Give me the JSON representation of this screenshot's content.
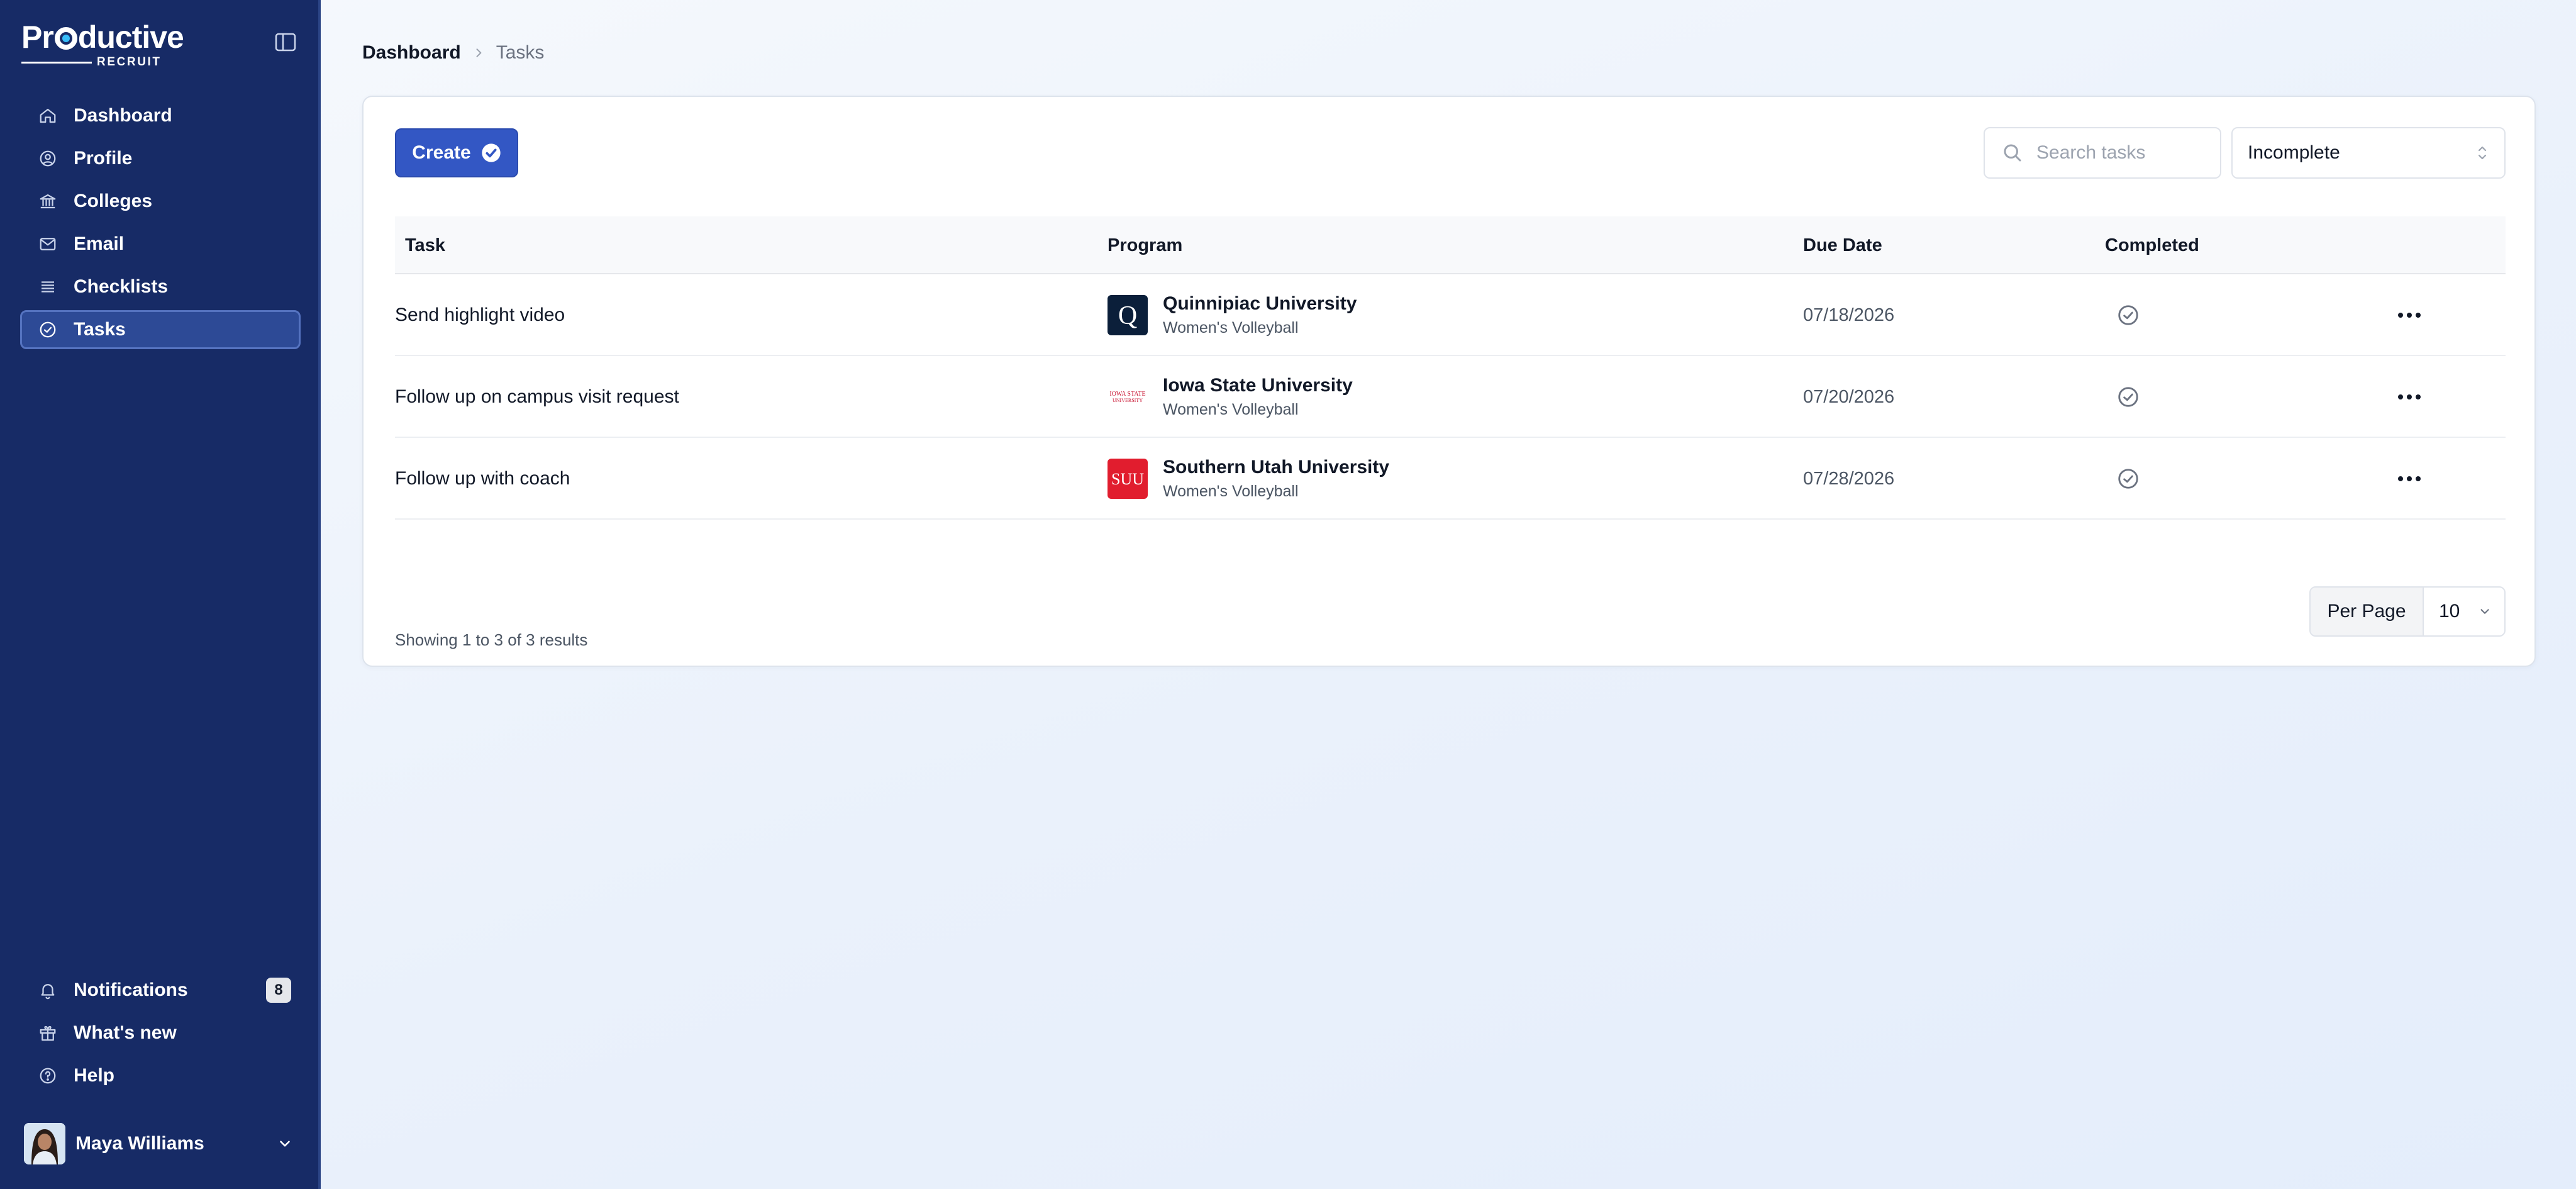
{
  "app": {
    "logo_main_pre": "Pr",
    "logo_main_post": "ductive",
    "logo_sub": "RECRUIT"
  },
  "sidebar": {
    "items": [
      {
        "label": "Dashboard",
        "icon": "home-icon"
      },
      {
        "label": "Profile",
        "icon": "user-circle-icon"
      },
      {
        "label": "Colleges",
        "icon": "building-icon"
      },
      {
        "label": "Email",
        "icon": "envelope-icon"
      },
      {
        "label": "Checklists",
        "icon": "list-icon"
      },
      {
        "label": "Tasks",
        "icon": "check-circle-icon",
        "active": true
      }
    ],
    "bottom_items": [
      {
        "label": "Notifications",
        "icon": "bell-icon",
        "badge": "8"
      },
      {
        "label": "What's new",
        "icon": "gift-icon"
      },
      {
        "label": "Help",
        "icon": "question-circle-icon"
      }
    ],
    "user": {
      "name": "Maya Williams"
    }
  },
  "breadcrumb": {
    "items": [
      "Dashboard",
      "Tasks"
    ]
  },
  "toolbar": {
    "create_label": "Create",
    "search_placeholder": "Search tasks",
    "status_filter": "Incomplete"
  },
  "table": {
    "headers": [
      "Task",
      "Program",
      "Due Date",
      "Completed"
    ],
    "rows": [
      {
        "task": "Send highlight video",
        "school": "Quinnipiac University",
        "sport": "Women's Volleyball",
        "due": "07/18/2026",
        "logo": "quinnipiac-logo"
      },
      {
        "task": "Follow up on campus visit request",
        "school": "Iowa State University",
        "sport": "Women's Volleyball",
        "due": "07/20/2026",
        "logo": "iowa-state-logo"
      },
      {
        "task": "Follow up with coach",
        "school": "Southern Utah University",
        "sport": "Women's Volleyball",
        "due": "07/28/2026",
        "logo": "suu-logo"
      }
    ]
  },
  "pagination": {
    "results_text": "Showing 1 to 3 of 3 results",
    "per_page_label": "Per Page",
    "per_page_value": "10"
  },
  "colors": {
    "sidebar_bg": "#172b66",
    "active_item": "#2d4a96",
    "primary": "#3357c4",
    "suu_red": "#e11d2e",
    "quinnipiac_navy": "#0b1f3a",
    "iowa_state_red": "#c8102e"
  },
  "logo_text": {
    "suu": "SUU",
    "quinnipiac": "Q",
    "iowa_state_1": "IOWA STATE",
    "iowa_state_2": "UNIVERSITY"
  }
}
